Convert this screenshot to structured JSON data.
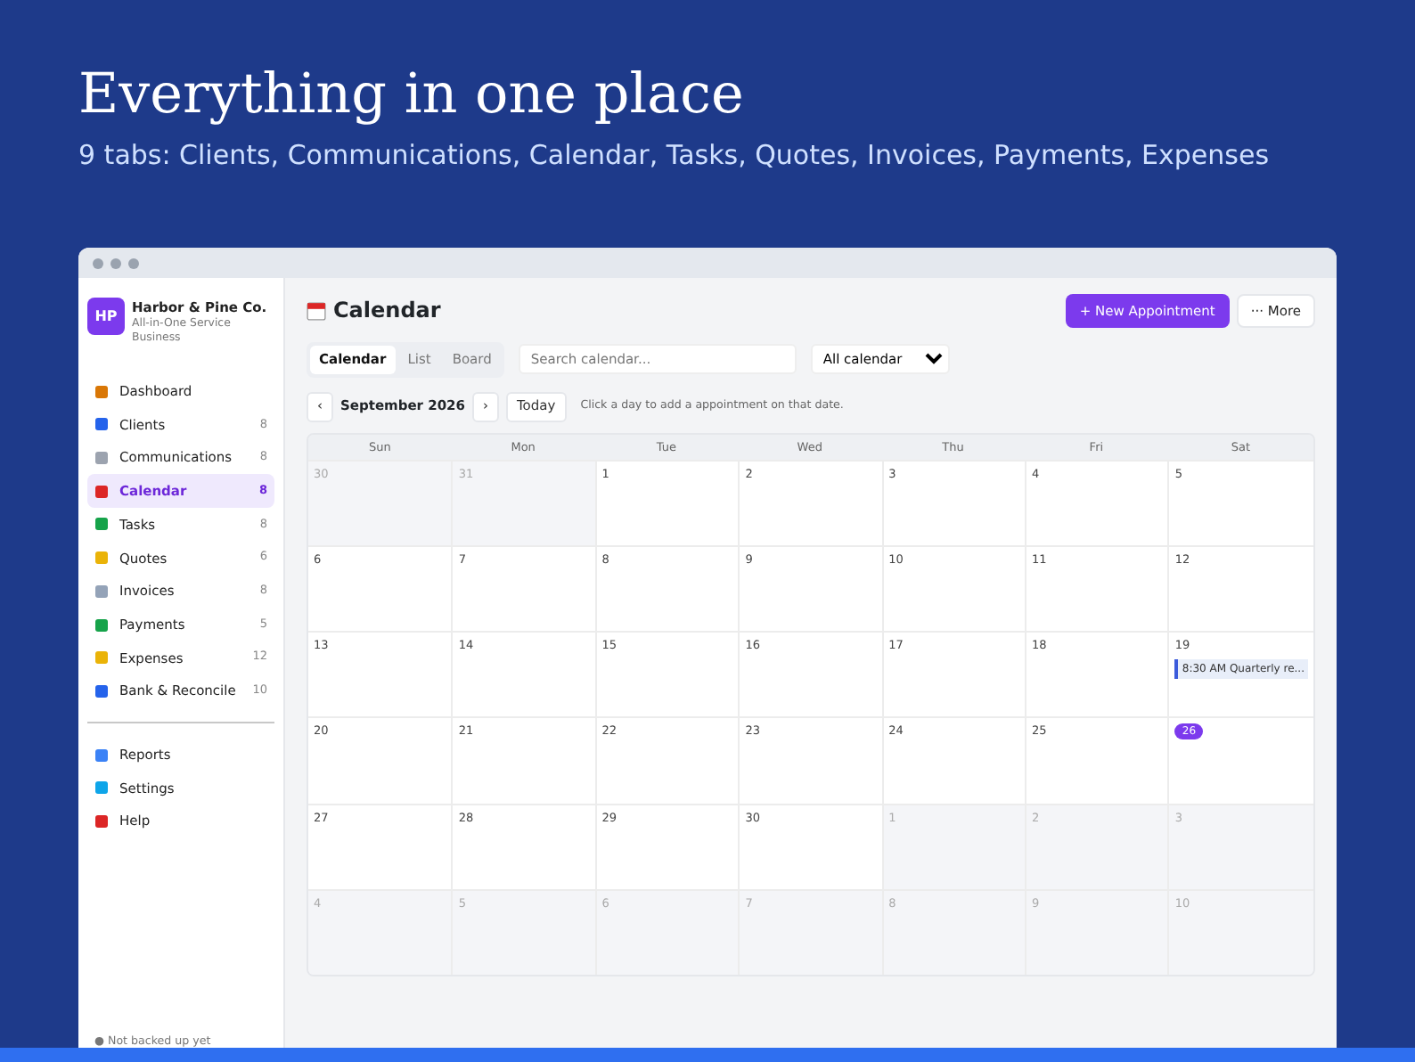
{
  "hero": {
    "title": "Everything in one place",
    "subtitle": "9 tabs: Clients, Communications, Calendar, Tasks, Quotes, Invoices, Payments, Expenses"
  },
  "sidebar": {
    "brand": {
      "initials": "HP",
      "name": "Harbor & Pine Co.",
      "tagline": "All-in-One Service Business"
    },
    "items": [
      {
        "label": "Dashboard",
        "selected": false
      },
      {
        "label": "Clients",
        "count": "8",
        "selected": false
      },
      {
        "label": "Communications",
        "count": "8",
        "selected": false
      },
      {
        "label": "Calendar",
        "count": "8",
        "selected": true
      },
      {
        "label": "Tasks",
        "count": "8",
        "selected": false
      },
      {
        "label": "Quotes",
        "count": "6",
        "selected": false
      },
      {
        "label": "Invoices",
        "count": "8",
        "selected": false
      },
      {
        "label": "Payments",
        "count": "5",
        "selected": false
      },
      {
        "label": "Expenses",
        "count": "12",
        "selected": false
      },
      {
        "label": "Bank & Reconcile",
        "count": "10",
        "selected": false
      }
    ],
    "bottom_items": [
      {
        "label": "Reports",
        "selected": false
      },
      {
        "label": "Settings",
        "selected": false
      },
      {
        "label": "Help",
        "selected": false
      }
    ],
    "footer": "● Not backed up yet"
  },
  "main": {
    "title": "Calendar",
    "buttons": [
      "+ New Appointment",
      "··· More"
    ],
    "view_tabs": [
      {
        "label": "Calendar",
        "selected": true
      },
      {
        "label": "List",
        "selected": false
      },
      {
        "label": "Board",
        "selected": false
      }
    ],
    "search": {
      "placeholder": "Search calendar..."
    },
    "filter": {
      "value": "All calendar"
    },
    "nav": {
      "prev": "‹",
      "month": "September 2026",
      "next": "›",
      "today": "Today",
      "hint": "Click a day to add a appointment on that date."
    },
    "weekdays": [
      "Sun",
      "Mon",
      "Tue",
      "Wed",
      "Thu",
      "Fri",
      "Sat"
    ],
    "weeks": [
      [
        {
          "day": "30",
          "in_month": false
        },
        {
          "day": "31",
          "in_month": false
        },
        {
          "day": "1",
          "in_month": true
        },
        {
          "day": "2",
          "in_month": true
        },
        {
          "day": "3",
          "in_month": true
        },
        {
          "day": "4",
          "in_month": true
        },
        {
          "day": "5",
          "in_month": true
        }
      ],
      [
        {
          "day": "6",
          "in_month": true
        },
        {
          "day": "7",
          "in_month": true
        },
        {
          "day": "8",
          "in_month": true
        },
        {
          "day": "9",
          "in_month": true
        },
        {
          "day": "10",
          "in_month": true
        },
        {
          "day": "11",
          "in_month": true
        },
        {
          "day": "12",
          "in_month": true
        }
      ],
      [
        {
          "day": "13",
          "in_month": true
        },
        {
          "day": "14",
          "in_month": true
        },
        {
          "day": "15",
          "in_month": true
        },
        {
          "day": "16",
          "in_month": true
        },
        {
          "day": "17",
          "in_month": true
        },
        {
          "day": "18",
          "in_month": true
        },
        {
          "day": "19",
          "in_month": true,
          "events": [
            "8:30 AM Quarterly re..."
          ]
        }
      ],
      [
        {
          "day": "20",
          "in_month": true
        },
        {
          "day": "21",
          "in_month": true
        },
        {
          "day": "22",
          "in_month": true
        },
        {
          "day": "23",
          "in_month": true
        },
        {
          "day": "24",
          "in_month": true
        },
        {
          "day": "25",
          "in_month": true
        },
        {
          "day": "26",
          "in_month": true,
          "today": true
        }
      ],
      [
        {
          "day": "27",
          "in_month": true
        },
        {
          "day": "28",
          "in_month": true
        },
        {
          "day": "29",
          "in_month": true
        },
        {
          "day": "30",
          "in_month": true
        },
        {
          "day": "1",
          "in_month": false
        },
        {
          "day": "2",
          "in_month": false
        },
        {
          "day": "3",
          "in_month": false
        }
      ],
      [
        {
          "day": "4",
          "in_month": false
        },
        {
          "day": "5",
          "in_month": false
        },
        {
          "day": "6",
          "in_month": false
        },
        {
          "day": "7",
          "in_month": false
        },
        {
          "day": "8",
          "in_month": false
        },
        {
          "day": "9",
          "in_month": false
        },
        {
          "day": "10",
          "in_month": false
        }
      ]
    ]
  }
}
